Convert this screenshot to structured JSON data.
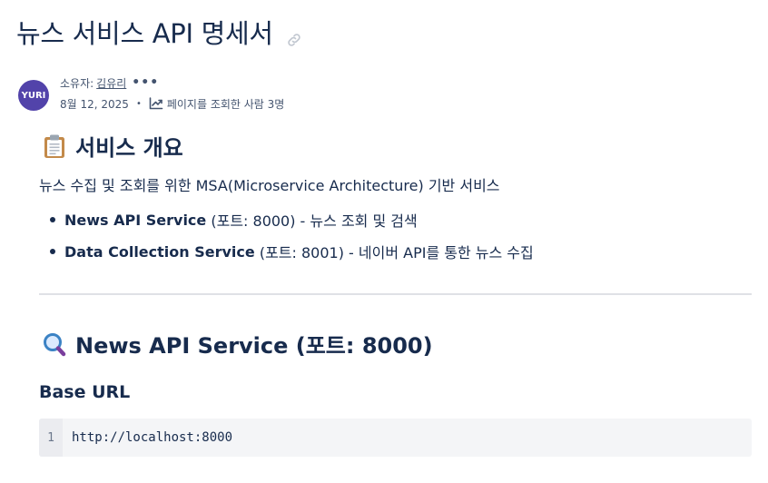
{
  "page": {
    "title": "뉴스 서비스 API 명세서"
  },
  "byline": {
    "avatar_initials": "YURI",
    "owner_label": "소유자:",
    "owner_name": "김유리",
    "more": "•••",
    "date": "8월 12, 2025",
    "separator": "•",
    "views": "페이지를 조회한 사람 3명"
  },
  "sections": {
    "overview": {
      "heading": "서비스 개요",
      "description": "뉴스 수집 및 조회를 위한 MSA(Microservice Architecture) 기반 서비스",
      "items": [
        {
          "name": "News API Service",
          "detail": " (포트: 8000) - 뉴스 조회 및 검색"
        },
        {
          "name": "Data Collection Service",
          "detail": " (포트: 8001) - 네이버 API를 통한 뉴스 수집"
        }
      ]
    },
    "news_api": {
      "heading": "News API Service (포트: 8000)",
      "base_url_heading": "Base URL",
      "code_line_number": "1",
      "code": "http://localhost:8000"
    }
  },
  "colors": {
    "avatar": "#5243aa",
    "text": "#172b4d",
    "code_bg": "#f4f5f7"
  },
  "icons": {
    "title_link": "link-icon",
    "analytics": "chart-line-icon",
    "overview_emoji": "clipboard-icon",
    "api_emoji": "magnifying-glass-icon"
  }
}
